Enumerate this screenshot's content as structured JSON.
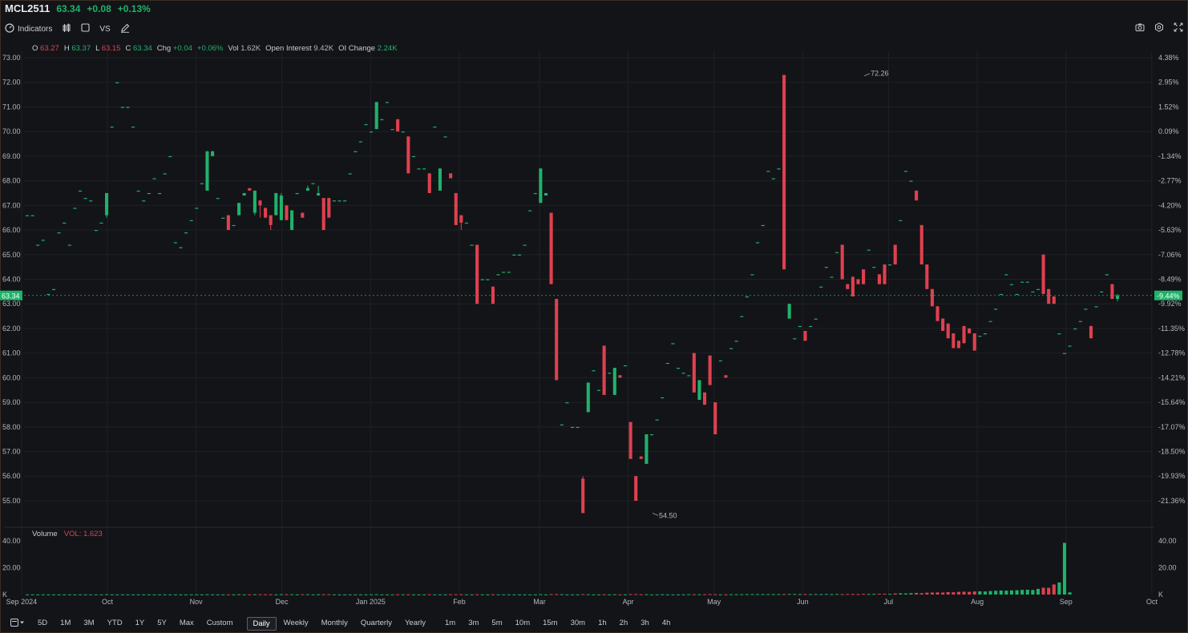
{
  "header": {
    "symbol": "MCL2511",
    "last": "63.34",
    "change": "+0.08",
    "change_pct": "+0.13%"
  },
  "toolbar": {
    "indicators_label": "Indicators",
    "vs_label": "VS",
    "icons_left": [
      "indicators-gauge-icon",
      "candle-type-icon",
      "rectangle-icon",
      "pencil-icon"
    ],
    "icons_right": [
      "camera-icon",
      "settings-icon",
      "fullscreen-icon"
    ]
  },
  "ohlc": {
    "o_label": "O",
    "o_value": "63.27",
    "h_label": "H",
    "h_value": "63.37",
    "l_label": "L",
    "l_value": "63.15",
    "c_label": "C",
    "c_value": "63.34",
    "chg_label": "Chg",
    "chg_value": "+0.04",
    "chg_pct": "+0.06%",
    "vol_label": "Vol",
    "vol_value": "1.62K",
    "oi_label": "Open Interest",
    "oi_value": "9.42K",
    "oichg_label": "OI Change",
    "oichg_value": "2.24K"
  },
  "volume_panel": {
    "label": "Volume",
    "value_label": "VOL: 1.623"
  },
  "ranges": [
    "5D",
    "1M",
    "3M",
    "YTD",
    "1Y",
    "5Y",
    "Max",
    "Custom",
    "Daily",
    "Weekly",
    "Monthly",
    "Quarterly",
    "Yearly",
    "1m",
    "3m",
    "5m",
    "10m",
    "15m",
    "30m",
    "1h",
    "2h",
    "3h",
    "4h"
  ],
  "active_range": "Daily",
  "colors": {
    "up": "#1fb26a",
    "down": "#e0404f",
    "background": "#131418",
    "grid": "#1f2126",
    "last_price_tag": "#1fb26a"
  },
  "chart_data": {
    "type": "candlestick",
    "y_left_ticks": [
      "73.00",
      "72.00",
      "71.00",
      "70.00",
      "69.00",
      "68.00",
      "67.00",
      "66.00",
      "65.00",
      "64.00",
      "63.00",
      "62.00",
      "61.00",
      "60.00",
      "59.00",
      "58.00",
      "57.00",
      "56.00",
      "55.00"
    ],
    "y_right_ticks": [
      "4.38%",
      "2.95%",
      "1.52%",
      "0.09%",
      "-1.34%",
      "-2.77%",
      "-4.20%",
      "-5.63%",
      "-7.06%",
      "-8.49%",
      "-9.92%",
      "-11.35%",
      "-12.78%",
      "-14.21%",
      "-15.64%",
      "-17.07%",
      "-18.50%",
      "-19.93%",
      "-21.36%"
    ],
    "ylim": [
      54.5,
      73.0
    ],
    "x_ticks": [
      "Sep 2024",
      "Oct",
      "Nov",
      "Dec",
      "Jan 2025",
      "Feb",
      "Mar",
      "Apr",
      "May",
      "Jun",
      "Jul",
      "Aug",
      "Sep",
      "Oct"
    ],
    "last_price": "63.34",
    "last_price_pct": "-9.44%",
    "annotations": [
      {
        "label": "72.26",
        "date": "2025-06-23",
        "value": 72.26
      },
      {
        "label": "54.50",
        "date": "2025-04-09",
        "value": 54.5
      }
    ],
    "volume_y_ticks": [
      "40.00",
      "20.00",
      "K"
    ],
    "volume_unit": "K",
    "date_range": [
      "2024-09-03",
      "2025-09-19"
    ],
    "candles": [
      [
        66.6,
        66.6,
        66.6,
        66.6
      ],
      [
        66.6,
        66.6,
        66.6,
        66.6
      ],
      [
        65.4,
        65.4,
        65.4,
        65.4
      ],
      [
        65.6,
        65.6,
        65.6,
        65.6
      ],
      [
        63.4,
        63.4,
        63.4,
        63.4
      ],
      [
        63.6,
        63.6,
        63.6,
        63.6
      ],
      [
        65.9,
        65.9,
        65.9,
        65.9
      ],
      [
        66.3,
        66.3,
        66.3,
        66.3
      ],
      [
        65.4,
        65.4,
        65.4,
        65.4
      ],
      [
        66.9,
        66.9,
        66.9,
        66.9
      ],
      [
        67.6,
        67.6,
        67.6,
        67.6
      ],
      [
        67.3,
        67.3,
        67.3,
        67.3
      ],
      [
        67.2,
        67.2,
        67.2,
        67.2
      ],
      [
        66.0,
        66.0,
        66.0,
        66.0
      ],
      [
        66.3,
        66.3,
        66.3,
        66.3
      ],
      [
        66.6,
        67.5,
        66.5,
        67.5
      ],
      [
        70.2,
        70.2,
        70.2,
        70.2
      ],
      [
        72.0,
        72.0,
        72.0,
        72.0
      ],
      [
        71.0,
        71.0,
        71.0,
        71.0
      ],
      [
        71.0,
        71.0,
        71.0,
        71.0
      ],
      [
        70.2,
        70.2,
        70.2,
        70.2
      ],
      [
        67.6,
        67.6,
        67.6,
        67.6
      ],
      [
        67.2,
        67.2,
        67.2,
        67.2
      ],
      [
        67.5,
        67.5,
        67.5,
        67.5
      ],
      [
        68.1,
        68.1,
        68.1,
        68.1
      ],
      [
        67.5,
        67.5,
        67.5,
        67.5
      ],
      [
        68.3,
        68.3,
        68.3,
        68.3
      ],
      [
        69.0,
        69.0,
        69.0,
        69.0
      ],
      [
        65.5,
        65.5,
        65.5,
        65.5
      ],
      [
        65.3,
        65.3,
        65.3,
        65.3
      ],
      [
        65.9,
        65.9,
        65.9,
        65.9
      ],
      [
        66.4,
        66.4,
        66.4,
        66.4
      ],
      [
        66.9,
        66.9,
        66.9,
        66.9
      ],
      [
        67.9,
        67.9,
        67.9,
        67.9
      ],
      [
        67.6,
        69.2,
        67.6,
        69.2
      ],
      [
        69.0,
        69.2,
        69.0,
        69.2
      ],
      [
        67.3,
        67.3,
        67.3,
        67.3
      ],
      [
        66.5,
        66.5,
        66.5,
        66.5
      ],
      [
        66.6,
        66.6,
        66.0,
        66.0
      ],
      [
        66.2,
        66.2,
        66.2,
        66.2
      ],
      [
        66.6,
        67.1,
        66.6,
        67.1
      ],
      [
        67.4,
        67.5,
        67.4,
        67.5
      ],
      [
        67.7,
        67.7,
        67.6,
        67.6
      ],
      [
        66.7,
        67.6,
        66.6,
        67.6
      ],
      [
        67.2,
        67.2,
        66.5,
        67.0
      ],
      [
        66.9,
        66.9,
        66.5,
        66.5
      ],
      [
        66.6,
        66.6,
        66.0,
        66.2
      ],
      [
        66.6,
        66.6,
        66.6,
        67.5
      ],
      [
        66.4,
        67.5,
        66.4,
        67.4
      ],
      [
        67.0,
        67.0,
        66.5,
        66.4
      ],
      [
        66.0,
        66.7,
        66.0,
        66.8
      ],
      [
        67.5,
        67.5,
        67.5,
        67.5
      ],
      [
        66.7,
        66.7,
        66.5,
        66.5
      ],
      [
        67.6,
        67.8,
        67.6,
        67.7
      ],
      [
        67.9,
        67.9,
        67.9,
        67.9
      ],
      [
        67.4,
        67.8,
        67.4,
        67.5
      ],
      [
        67.3,
        67.3,
        66.0,
        66.0
      ],
      [
        67.3,
        67.3,
        66.5,
        66.5
      ],
      [
        67.2,
        67.2,
        67.2,
        67.2
      ],
      [
        67.2,
        67.2,
        67.2,
        67.2
      ],
      [
        67.2,
        67.2,
        67.2,
        67.2
      ],
      [
        68.3,
        68.3,
        68.3,
        68.3
      ],
      [
        69.2,
        69.2,
        69.2,
        69.2
      ],
      [
        69.6,
        69.6,
        69.6,
        69.6
      ],
      [
        70.3,
        70.3,
        70.3,
        70.3
      ],
      [
        70.0,
        70.0,
        70.0,
        70.0
      ],
      [
        70.1,
        71.2,
        70.1,
        71.2
      ],
      [
        70.5,
        70.5,
        70.5,
        70.5
      ],
      [
        71.2,
        71.2,
        71.2,
        71.2
      ],
      [
        70.1,
        70.1,
        70.1,
        70.1
      ],
      [
        70.5,
        70.5,
        70.0,
        70.0
      ],
      [
        70.0,
        70.0,
        70.0,
        70.0
      ],
      [
        69.8,
        69.8,
        68.3,
        68.3
      ],
      [
        69.0,
        69.0,
        69.0,
        69.0
      ],
      [
        68.5,
        68.5,
        68.5,
        68.5
      ],
      [
        68.5,
        68.5,
        68.5,
        68.5
      ],
      [
        68.3,
        68.3,
        67.5,
        67.5
      ],
      [
        70.2,
        70.2,
        70.2,
        70.2
      ],
      [
        67.6,
        68.5,
        67.6,
        68.5
      ],
      [
        69.8,
        69.8,
        69.8,
        69.8
      ],
      [
        68.3,
        68.3,
        68.1,
        68.1
      ],
      [
        67.5,
        67.5,
        66.2,
        66.2
      ],
      [
        66.6,
        66.6,
        66.0,
        66.3
      ],
      [
        66.3,
        66.3,
        66.3,
        66.3
      ],
      [
        65.4,
        65.4,
        65.4,
        65.4
      ],
      [
        65.4,
        65.4,
        63.0,
        63.0
      ],
      [
        64.0,
        64.0,
        64.0,
        64.0
      ],
      [
        64.0,
        64.0,
        64.0,
        64.0
      ],
      [
        63.7,
        63.7,
        63.0,
        63.0
      ],
      [
        64.2,
        64.2,
        64.2,
        64.2
      ],
      [
        64.3,
        64.3,
        64.3,
        64.3
      ],
      [
        64.3,
        64.3,
        64.3,
        64.3
      ],
      [
        65.0,
        65.0,
        65.0,
        65.0
      ],
      [
        65.0,
        65.0,
        65.0,
        65.0
      ],
      [
        65.4,
        65.4,
        65.4,
        65.4
      ],
      [
        66.8,
        66.8,
        66.8,
        66.8
      ],
      [
        67.5,
        67.5,
        67.5,
        67.5
      ],
      [
        67.1,
        68.5,
        67.1,
        68.5
      ],
      [
        67.4,
        67.5,
        67.4,
        67.5
      ],
      [
        66.7,
        66.7,
        63.8,
        63.8
      ],
      [
        63.2,
        63.2,
        59.9,
        59.9
      ],
      [
        58.1,
        58.1,
        58.1,
        58.1
      ],
      [
        59.0,
        59.0,
        59.0,
        59.0
      ],
      [
        58.0,
        58.0,
        58.0,
        58.0
      ],
      [
        58.0,
        58.0,
        58.0,
        58.0
      ],
      [
        55.9,
        56.0,
        54.5,
        54.5
      ],
      [
        58.6,
        59.8,
        58.6,
        59.8
      ],
      [
        60.3,
        60.3,
        60.3,
        60.3
      ],
      [
        59.5,
        59.5,
        59.5,
        59.5
      ],
      [
        61.3,
        61.3,
        59.3,
        59.3
      ],
      [
        60.2,
        60.2,
        60.2,
        60.2
      ],
      [
        59.3,
        60.4,
        59.3,
        60.4
      ],
      [
        60.1,
        60.1,
        60.0,
        60.0
      ],
      [
        60.5,
        60.5,
        60.5,
        60.5
      ],
      [
        58.2,
        58.2,
        56.7,
        56.7
      ],
      [
        56.0,
        56.0,
        55.0,
        55.0
      ],
      [
        56.8,
        56.8,
        56.7,
        56.7
      ],
      [
        56.5,
        57.7,
        56.5,
        57.7
      ],
      [
        57.7,
        57.7,
        57.7,
        57.7
      ],
      [
        58.3,
        58.3,
        58.3,
        58.3
      ],
      [
        59.2,
        59.2,
        59.2,
        59.2
      ],
      [
        60.6,
        60.6,
        60.6,
        60.6
      ],
      [
        61.4,
        61.4,
        61.4,
        61.4
      ],
      [
        60.4,
        60.4,
        60.4,
        60.4
      ],
      [
        60.2,
        60.2,
        60.2,
        60.2
      ],
      [
        60.1,
        60.1,
        60.1,
        60.1
      ],
      [
        61.0,
        61.0,
        59.4,
        59.4
      ],
      [
        59.1,
        59.9,
        59.1,
        59.9
      ],
      [
        59.4,
        59.4,
        58.9,
        58.9
      ],
      [
        60.9,
        60.9,
        59.7,
        59.7
      ],
      [
        59.0,
        59.0,
        57.7,
        57.7
      ],
      [
        60.7,
        60.7,
        60.7,
        60.7
      ],
      [
        60.1,
        60.1,
        60.0,
        60.0
      ],
      [
        61.2,
        61.2,
        61.2,
        61.2
      ],
      [
        61.5,
        61.5,
        61.5,
        61.5
      ],
      [
        62.5,
        62.5,
        62.5,
        62.5
      ],
      [
        63.3,
        63.3,
        63.3,
        63.3
      ],
      [
        64.2,
        64.2,
        64.2,
        64.2
      ],
      [
        65.5,
        65.5,
        65.5,
        65.5
      ],
      [
        66.2,
        66.2,
        66.2,
        66.2
      ],
      [
        68.4,
        68.4,
        68.4,
        68.4
      ],
      [
        68.1,
        68.1,
        68.1,
        68.1
      ],
      [
        68.5,
        68.5,
        68.5,
        68.5
      ],
      [
        72.3,
        72.3,
        64.4,
        64.4
      ],
      [
        62.4,
        63.0,
        62.4,
        63.0
      ],
      [
        61.6,
        61.6,
        61.6,
        61.6
      ],
      [
        62.1,
        62.1,
        62.1,
        62.1
      ],
      [
        61.9,
        61.9,
        61.5,
        61.5
      ],
      [
        62.1,
        62.1,
        62.1,
        62.1
      ],
      [
        62.4,
        62.4,
        62.4,
        62.4
      ],
      [
        63.7,
        63.7,
        63.7,
        63.7
      ],
      [
        64.5,
        64.5,
        64.5,
        64.5
      ],
      [
        64.1,
        64.1,
        64.1,
        64.1
      ],
      [
        65.1,
        65.1,
        65.1,
        65.1
      ],
      [
        65.4,
        65.4,
        64.0,
        64.0
      ],
      [
        63.8,
        63.8,
        63.6,
        63.6
      ],
      [
        64.1,
        64.1,
        63.3,
        63.3
      ],
      [
        64.0,
        64.0,
        63.8,
        63.8
      ],
      [
        64.4,
        64.4,
        63.8,
        63.8
      ],
      [
        65.2,
        65.2,
        65.2,
        65.2
      ],
      [
        64.5,
        64.5,
        64.5,
        64.5
      ],
      [
        64.2,
        64.2,
        63.8,
        63.8
      ],
      [
        64.6,
        64.6,
        63.8,
        63.8
      ],
      [
        64.6,
        64.6,
        64.6,
        64.6
      ],
      [
        65.4,
        65.4,
        64.6,
        64.6
      ],
      [
        66.4,
        66.4,
        66.4,
        66.4
      ],
      [
        68.4,
        68.4,
        68.4,
        68.4
      ],
      [
        68.0,
        68.0,
        68.0,
        68.0
      ],
      [
        67.6,
        67.6,
        67.2,
        67.2
      ],
      [
        66.2,
        66.2,
        64.6,
        64.6
      ],
      [
        64.6,
        64.6,
        63.6,
        63.6
      ],
      [
        63.6,
        63.6,
        62.9,
        62.9
      ],
      [
        62.9,
        62.9,
        62.3,
        62.3
      ],
      [
        62.4,
        62.4,
        61.9,
        61.9
      ],
      [
        62.2,
        62.2,
        61.6,
        61.6
      ],
      [
        61.8,
        61.8,
        61.2,
        61.2
      ],
      [
        61.5,
        61.5,
        61.2,
        61.2
      ],
      [
        62.1,
        62.1,
        61.4,
        61.4
      ],
      [
        62.0,
        62.0,
        61.8,
        61.8
      ],
      [
        61.8,
        61.8,
        61.1,
        61.1
      ],
      [
        61.7,
        61.7,
        61.7,
        61.7
      ],
      [
        61.8,
        61.8,
        61.8,
        61.8
      ],
      [
        62.3,
        62.3,
        62.3,
        62.3
      ],
      [
        62.8,
        62.8,
        62.8,
        62.8
      ],
      [
        63.4,
        63.4,
        63.4,
        63.4
      ],
      [
        64.2,
        64.2,
        64.2,
        64.2
      ],
      [
        63.8,
        63.8,
        63.8,
        63.8
      ],
      [
        63.4,
        63.4,
        63.4,
        63.4
      ],
      [
        63.9,
        63.9,
        63.9,
        63.9
      ],
      [
        63.9,
        63.9,
        63.9,
        63.9
      ],
      [
        63.5,
        63.5,
        63.5,
        63.5
      ],
      [
        63.6,
        63.6,
        63.6,
        63.6
      ],
      [
        65.0,
        65.0,
        63.4,
        63.4
      ],
      [
        63.6,
        63.6,
        63.0,
        63.0
      ],
      [
        63.3,
        63.3,
        63.0,
        63.0
      ],
      [
        61.8,
        61.8,
        61.8,
        61.8
      ],
      [
        61.0,
        61.0,
        61.0,
        61.0
      ],
      [
        61.3,
        61.3,
        61.3,
        61.3
      ],
      [
        62.0,
        62.0,
        62.0,
        62.0
      ],
      [
        62.3,
        62.3,
        62.3,
        62.3
      ],
      [
        62.8,
        62.8,
        62.8,
        62.8
      ],
      [
        62.1,
        62.1,
        61.6,
        61.6
      ],
      [
        62.9,
        62.9,
        62.9,
        62.9
      ],
      [
        63.5,
        63.5,
        63.5,
        63.5
      ],
      [
        64.2,
        64.2,
        64.2,
        64.2
      ],
      [
        63.8,
        63.8,
        63.2,
        63.2
      ],
      [
        63.2,
        63.4,
        63.1,
        63.34
      ]
    ],
    "volume": [
      0.1,
      0.1,
      0.1,
      0.1,
      0.1,
      0.1,
      0.1,
      0.1,
      0.1,
      0.1,
      0.1,
      0.1,
      0.1,
      0.1,
      0.1,
      0.2,
      0.1,
      0.1,
      0.1,
      0.1,
      0.1,
      0.1,
      0.1,
      0.1,
      0.1,
      0.1,
      0.1,
      0.1,
      0.1,
      0.1,
      0.1,
      0.1,
      0.1,
      0.1,
      0.2,
      0.1,
      0.1,
      0.1,
      0.1,
      0.1,
      0.2,
      0.1,
      0.1,
      0.2,
      0.2,
      0.2,
      0.2,
      0.1,
      0.2,
      0.2,
      0.2,
      0.1,
      0.2,
      0.2,
      0.1,
      0.2,
      0.2,
      0.2,
      0.1,
      0.1,
      0.1,
      0.1,
      0.1,
      0.1,
      0.1,
      0.1,
      0.2,
      0.1,
      0.1,
      0.1,
      0.2,
      0.1,
      0.2,
      0.1,
      0.1,
      0.1,
      0.2,
      0.1,
      0.2,
      0.1,
      0.2,
      0.2,
      0.2,
      0.1,
      0.1,
      0.2,
      0.1,
      0.1,
      0.2,
      0.1,
      0.1,
      0.1,
      0.1,
      0.1,
      0.1,
      0.1,
      0.1,
      0.2,
      0.1,
      0.3,
      0.3,
      0.2,
      0.1,
      0.1,
      0.1,
      0.3,
      0.2,
      0.1,
      0.1,
      0.2,
      0.1,
      0.2,
      0.1,
      0.1,
      0.3,
      0.3,
      0.2,
      0.2,
      0.1,
      0.1,
      0.2,
      0.1,
      0.1,
      0.1,
      0.1,
      0.2,
      0.2,
      0.2,
      0.2,
      0.3,
      0.2,
      0.1,
      0.1,
      0.2,
      0.2,
      0.2,
      0.3,
      0.3,
      0.3,
      0.3,
      0.3,
      0.3,
      0.3,
      0.3,
      0.4,
      0.4,
      0.3,
      0.3,
      0.3,
      0.4,
      0.3,
      0.4,
      0.3,
      0.4,
      0.3,
      0.4,
      0.4,
      0.3,
      0.5,
      0.4,
      0.5,
      0.6,
      0.6,
      0.5,
      0.8,
      0.9,
      0.8,
      1.0,
      1.2,
      1.0,
      1.4,
      1.5,
      1.6,
      1.5,
      1.8,
      1.7,
      2.0,
      2.1,
      2.0,
      2.3,
      2.4,
      2.3,
      2.6,
      2.8,
      3.0,
      2.9,
      3.1,
      3.2,
      3.5,
      3.6,
      3.4,
      4.2,
      5.1,
      5.0,
      7.5,
      9.0,
      38.5,
      1.623
    ]
  }
}
